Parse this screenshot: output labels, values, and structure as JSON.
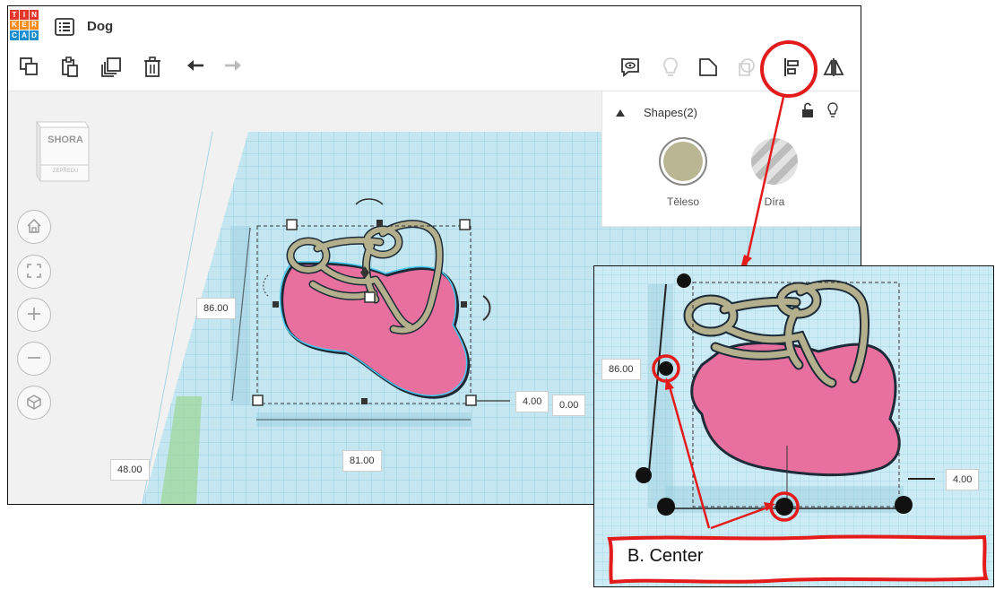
{
  "app": {
    "logo_letters": [
      "T",
      "I",
      "N",
      "K",
      "E",
      "R",
      "C",
      "A",
      "D"
    ],
    "logo_colors": [
      "#e2362c",
      "#e2362c",
      "#e2362c",
      "#f28c1c",
      "#f28c1c",
      "#f28c1c",
      "#1f8ece",
      "#1f8ece",
      "#1f8ece"
    ],
    "design_name": "Dog"
  },
  "toolbar": {
    "left_icons": [
      "copy-icon",
      "paste-icon",
      "duplicate-icon",
      "delete-icon",
      "undo-icon",
      "redo-icon"
    ],
    "right_icons": [
      "notes-icon",
      "lightbulb-icon",
      "shape-icon",
      "hole-icon",
      "align-icon",
      "mirror-icon"
    ]
  },
  "viewcube": {
    "top_label": "SHORA",
    "front_label": "ZEPŘEDU"
  },
  "shapes_panel": {
    "title": "Shapes(2)",
    "solid_label": "Těleso",
    "hole_label": "Díra",
    "solid_color": "#b8b693",
    "hole_color": "#c9c9c9"
  },
  "dimensions": {
    "height": "86.00",
    "width": "81.00",
    "depth": "4.00",
    "elevation": "0.00",
    "grid_offset": "48.00"
  },
  "zoom_dimensions": {
    "height": "86.00",
    "depth": "4.00"
  },
  "annotation": {
    "label": "B. Center",
    "color": "#e31b1b"
  },
  "colors": {
    "grid": "#bfe3ef",
    "pink": "#e8709f",
    "accent_red": "#e31b1b"
  }
}
